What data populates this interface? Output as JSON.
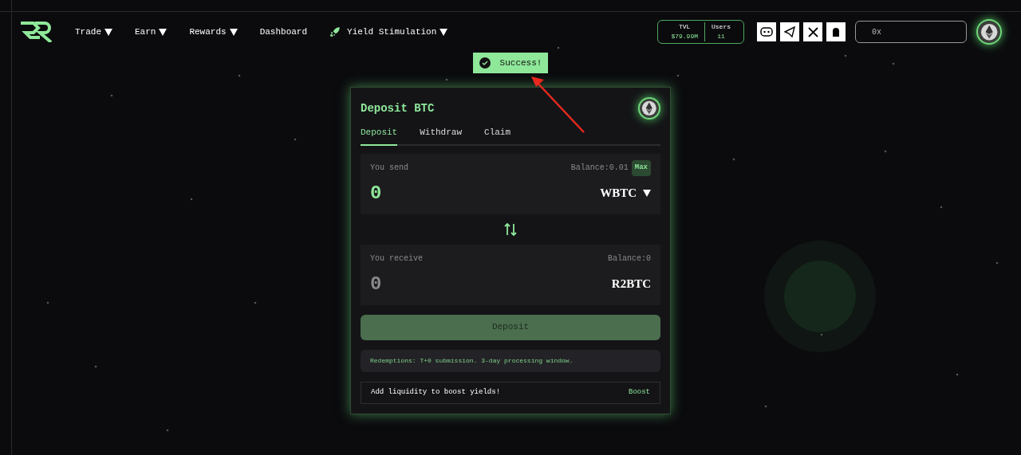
{
  "nav": {
    "items": [
      {
        "label": "Trade",
        "dropdown": true,
        "rocket": false
      },
      {
        "label": "Earn",
        "dropdown": true,
        "rocket": false
      },
      {
        "label": "Rewards",
        "dropdown": true,
        "rocket": false
      },
      {
        "label": "Dashboard",
        "dropdown": false,
        "rocket": false
      },
      {
        "label": "Yield Stimulation",
        "dropdown": true,
        "rocket": true
      }
    ]
  },
  "stats": [
    {
      "label": "TVL",
      "value": "$79.99M"
    },
    {
      "label": "Users",
      "value": "11"
    }
  ],
  "wallet": {
    "address": "0x"
  },
  "toast": {
    "message": "Success!"
  },
  "card": {
    "title": "Deposit BTC",
    "tabs": [
      {
        "label": "Deposit",
        "selected": true
      },
      {
        "label": "Withdraw",
        "selected": false
      },
      {
        "label": "Claim",
        "selected": false
      }
    ],
    "send": {
      "label": "You send",
      "balance": "Balance:0.01",
      "max": "Max",
      "amount": "0",
      "token": "WBTC",
      "token_dropdown": true
    },
    "receive": {
      "label": "You receive",
      "balance": "Balance:0",
      "amount": "0",
      "token": "R2BTC",
      "token_dropdown": false
    },
    "submit": {
      "label": "Deposit",
      "disabled": true
    },
    "notice": "Redemptions: T+0 submission. 3-day processing window.",
    "boost": {
      "text": "Add liquidity to boost yields!",
      "link": "Boost"
    }
  }
}
